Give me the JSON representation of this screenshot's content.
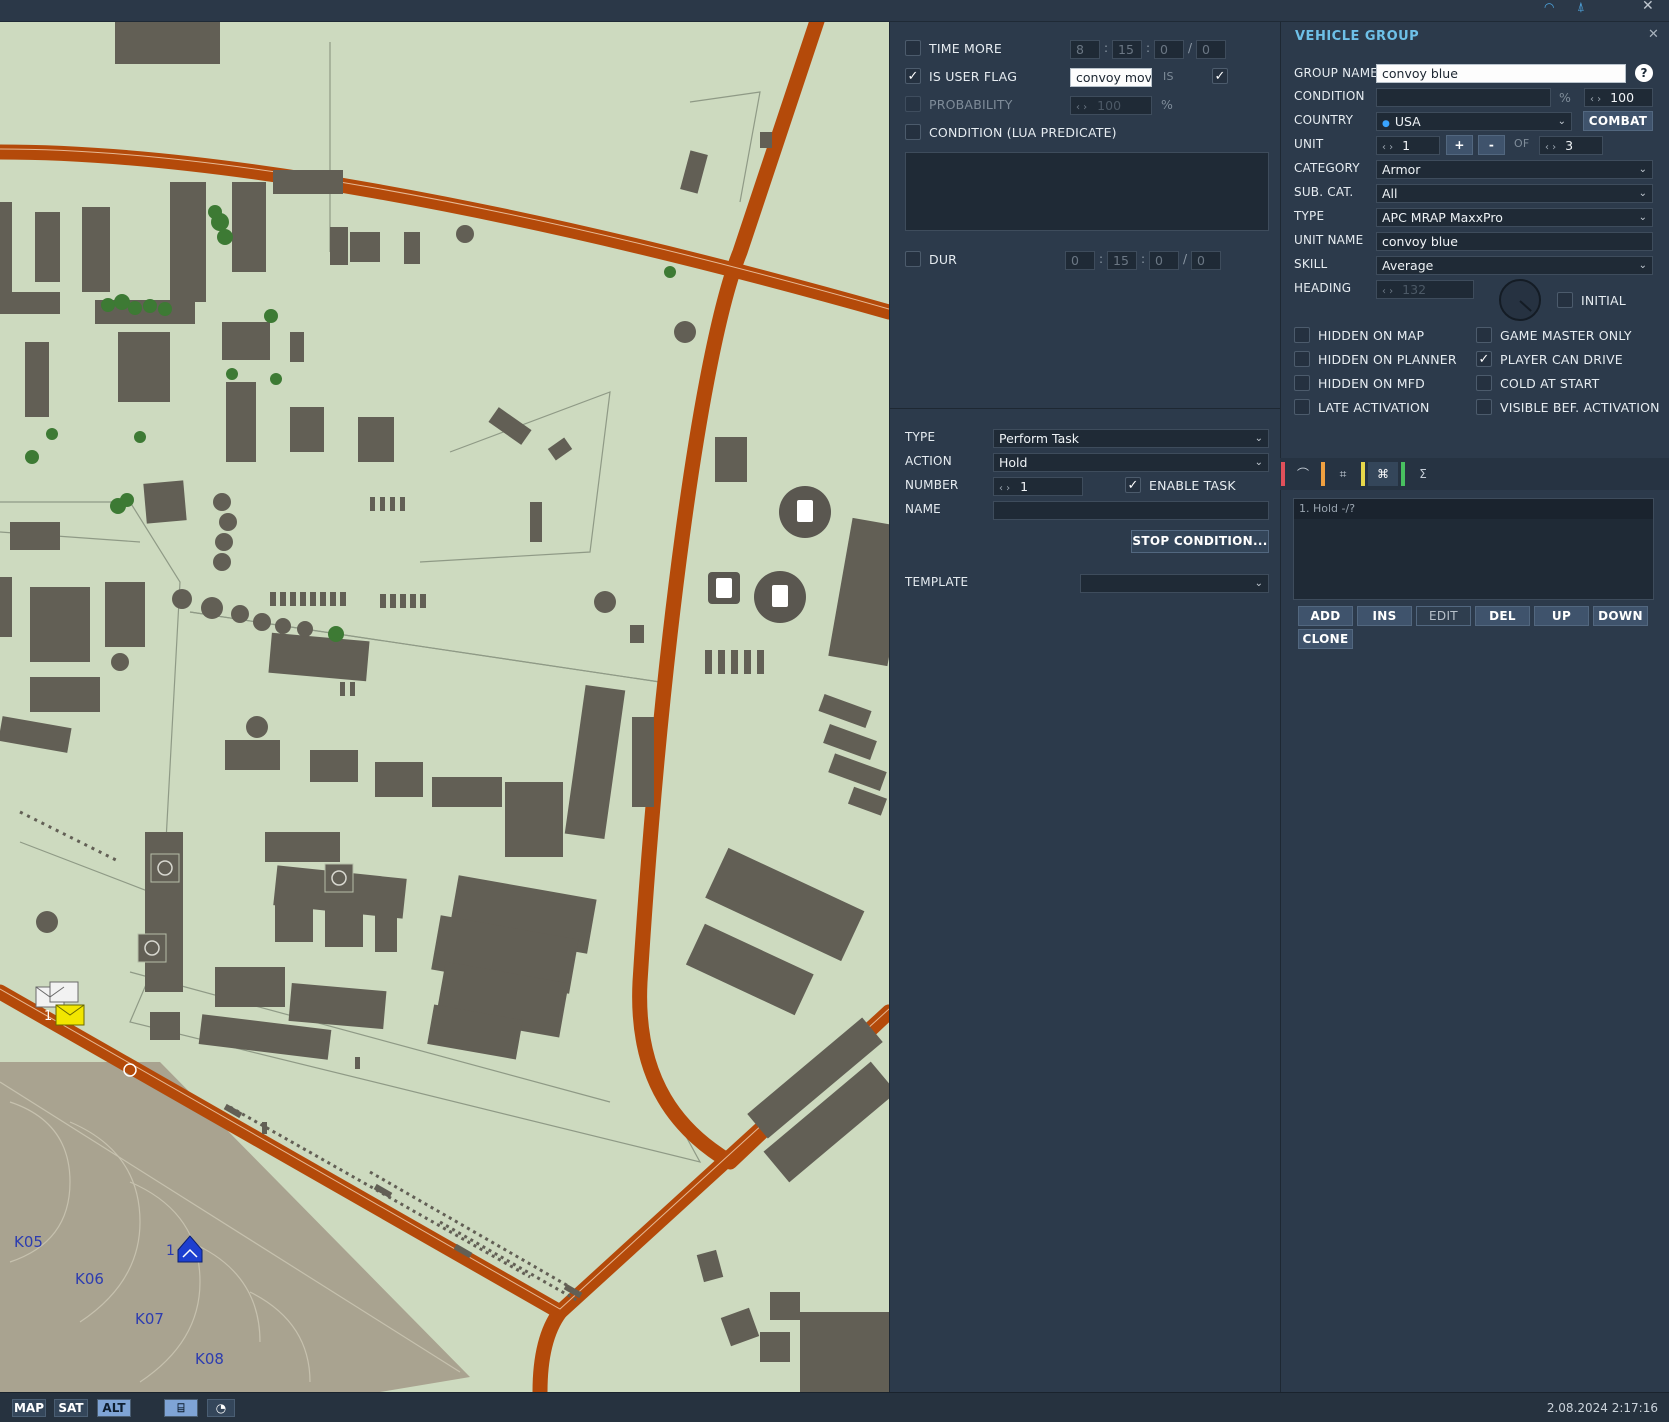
{
  "map": {
    "taxi_labels": [
      "K05",
      "K06",
      "K07",
      "K08"
    ],
    "unit_numbers": [
      "1",
      "1"
    ]
  },
  "trigger": {
    "time_more": {
      "label": "TIME MORE",
      "checked": false,
      "values": [
        "8",
        "15",
        "0",
        "0"
      ]
    },
    "is_user_flag": {
      "label": "IS USER FLAG",
      "checked": true,
      "flag_name": "convoy move",
      "is_label": "IS",
      "value_checked": true
    },
    "probability": {
      "label": "PROBABILITY",
      "checked": false,
      "value": "100",
      "unit": "%"
    },
    "condition_lua": {
      "label": "CONDITION (LUA PREDICATE)",
      "checked": false,
      "text": ""
    },
    "dur": {
      "label": "DUR",
      "checked": false,
      "values": [
        "0",
        "15",
        "0",
        "0"
      ]
    }
  },
  "task": {
    "type_label": "TYPE",
    "type_value": "Perform Task",
    "action_label": "ACTION",
    "action_value": "Hold",
    "number_label": "NUMBER",
    "number_value": "1",
    "enable_task_label": "ENABLE TASK",
    "enable_task_checked": true,
    "name_label": "NAME",
    "name_value": "",
    "stop_condition_button": "STOP CONDITION...",
    "template_label": "TEMPLATE",
    "template_value": ""
  },
  "vehicle_group": {
    "title": "VEHICLE GROUP",
    "group_name_label": "GROUP NAME",
    "group_name_value": "convoy blue",
    "help": "?",
    "condition_label": "CONDITION",
    "condition_value": "",
    "condition_unit": "%",
    "condition_pct": "100",
    "country_label": "COUNTRY",
    "country_value": "USA",
    "combat_button": "COMBAT",
    "unit_label": "UNIT",
    "unit_value": "1",
    "plus": "+",
    "minus": "-",
    "of_label": "OF",
    "unit_total": "3",
    "category_label": "CATEGORY",
    "category_value": "Armor",
    "subcat_label": "SUB. CAT.",
    "subcat_value": "All",
    "type_label": "TYPE",
    "type_value": "APC MRAP MaxxPro",
    "unit_name_label": "UNIT NAME",
    "unit_name_value": "convoy blue",
    "skill_label": "SKILL",
    "skill_value": "Average",
    "heading_label": "HEADING",
    "heading_value": "132",
    "initial_label": "INITIAL",
    "flags_left": [
      {
        "label": "HIDDEN ON MAP",
        "checked": false
      },
      {
        "label": "HIDDEN ON PLANNER",
        "checked": false
      },
      {
        "label": "HIDDEN ON MFD",
        "checked": false
      },
      {
        "label": "LATE ACTIVATION",
        "checked": false
      }
    ],
    "flags_right": [
      {
        "label": "GAME MASTER ONLY",
        "checked": false
      },
      {
        "label": "PLAYER CAN DRIVE",
        "checked": true
      },
      {
        "label": "COLD AT START",
        "checked": false
      },
      {
        "label": "VISIBLE BEF. ACTIVATION",
        "checked": false
      }
    ],
    "tab_colors": [
      "#e0505a",
      "#f0a040",
      "#e8d84a",
      "#48c060"
    ],
    "task_list": [
      "1. Hold -/?"
    ],
    "buttons": [
      "ADD",
      "INS",
      "EDIT",
      "DEL",
      "UP",
      "DOWN",
      "CLONE"
    ]
  },
  "bottom_bar": {
    "modes": [
      "MAP",
      "SAT",
      "ALT"
    ],
    "active_mode": "ALT",
    "datetime": "2.08.2024 2:17:16"
  }
}
